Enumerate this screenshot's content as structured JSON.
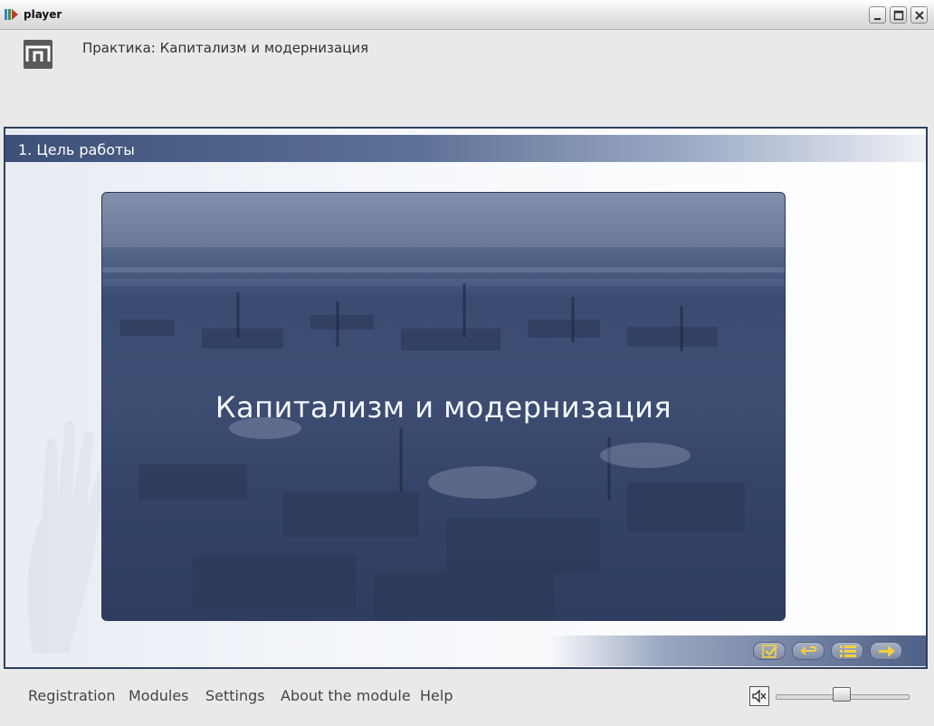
{
  "window": {
    "title": "player",
    "controls": {
      "minimize": "minimize-icon",
      "maximize": "maximize-icon",
      "close": "close-icon"
    }
  },
  "header": {
    "logo_icon": "p-logo-icon",
    "title": "Практика: Капитализм и модернизация"
  },
  "section": {
    "title": "1. Цель работы"
  },
  "slide": {
    "text": "Капитализм и модернизация",
    "image": "industrial-city-panorama"
  },
  "nav_buttons": [
    {
      "name": "check",
      "icon": "checkmark-icon"
    },
    {
      "name": "back",
      "icon": "return-arrow-icon"
    },
    {
      "name": "contents",
      "icon": "list-icon"
    },
    {
      "name": "next",
      "icon": "arrow-right-icon"
    }
  ],
  "footer": {
    "menu": [
      "Registration",
      "Modules",
      "Settings",
      "About the module",
      "Help"
    ],
    "volume_icon": "speaker-mute-icon",
    "volume_level": 0.5
  },
  "colors": {
    "frame_border": "#2f3f5e",
    "section_bar": "#3d5078",
    "nav_arrow": "#f2d23a"
  }
}
